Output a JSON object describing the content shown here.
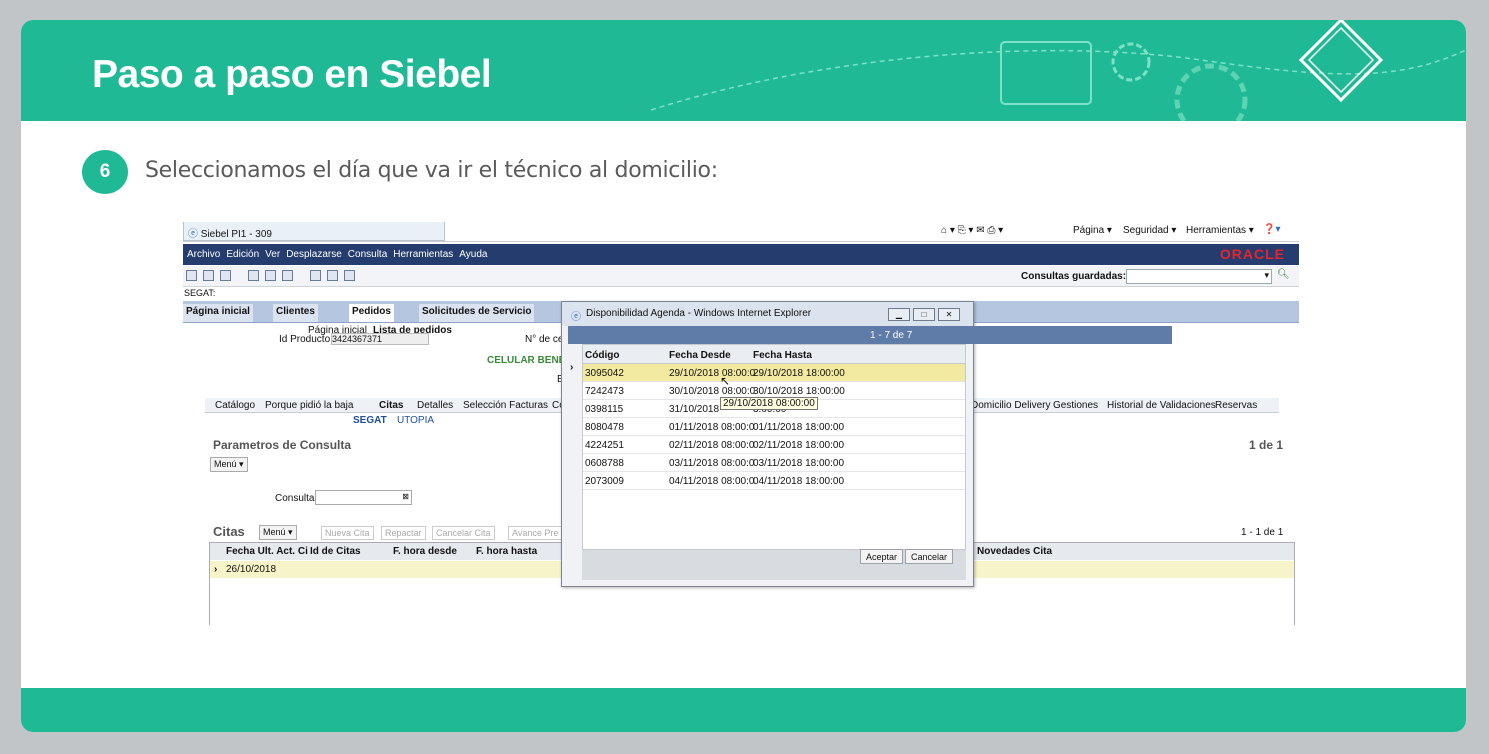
{
  "header": {
    "title": "Paso a paso en Siebel"
  },
  "step": {
    "number": "6",
    "text": "Seleccionamos el día que va ir el técnico al domicilio:"
  },
  "browser": {
    "tab_title": "Siebel PI1 - 309",
    "toolbar": [
      "Página ▾",
      "Seguridad ▾",
      "Herramientas ▾"
    ],
    "menus": [
      "Archivo",
      "Edición",
      "Ver",
      "Desplazarse",
      "Consulta",
      "Herramientas",
      "Ayuda"
    ],
    "oracle": "ORACLE",
    "saved_queries": "Consultas guardadas:"
  },
  "siebel": {
    "segat_label": "SEGAT:",
    "screen_tabs": [
      "Página inicial",
      "Clientes",
      "Pedidos",
      "Solicitudes de Servicio"
    ],
    "breadcrumb": {
      "home": "Página inicial",
      "current": "Lista de pedidos"
    },
    "id_producto": "Id Producto:",
    "id_producto_value": "3424367371",
    "no_de": "N° de ce",
    "celular": "CELULAR BENEFI",
    "e_label": "E",
    "view_tabs_left": [
      "Catálogo",
      "Porque pidió la baja",
      "Citas",
      "Detalles",
      "Selección Facturas",
      "Co"
    ],
    "view_tabs_right": [
      "Domicilio Delivery",
      "Gestiones",
      "Historial de Validaciones",
      "Reservas"
    ],
    "sub_tabs": [
      "SEGAT",
      "UTOPIA"
    ],
    "params_title": "Parametros de Consulta",
    "params_count": "1 de 1",
    "menu_label": "Menú ▾",
    "consulta_label": "Consulta:",
    "citas_title": "Citas",
    "citas_count": "1 - 1 de 1",
    "citas_buttons": [
      "Nueva Cita",
      "Repactar",
      "Cancelar Cita",
      "Avance Pre"
    ],
    "citas_columns": [
      "Fecha Ult. Act. Ci",
      "Id de Citas",
      "F. hora desde",
      "F. hora hasta",
      "Novedades Cita"
    ],
    "citas_row": "26/10/2018"
  },
  "dialog": {
    "title": "Disponibilidad Agenda - Windows Internet Explorer",
    "count": "1 - 7 de 7",
    "columns": [
      "Código",
      "Fecha Desde",
      "Fecha Hasta"
    ],
    "rows": [
      [
        "3095042",
        "29/10/2018 08:00:0",
        "29/10/2018 18:00:00"
      ],
      [
        "7242473",
        "30/10/2018 08:00:0",
        "30/10/2018 18:00:00"
      ],
      [
        "0398115",
        "31/10/2018",
        "3:00:00"
      ],
      [
        "8080478",
        "01/11/2018 08:00:0",
        "01/11/2018 18:00:00"
      ],
      [
        "4224251",
        "02/11/2018 08:00:0",
        "02/11/2018 18:00:00"
      ],
      [
        "0608788",
        "03/11/2018 08:00:0",
        "03/11/2018 18:00:00"
      ],
      [
        "2073009",
        "04/11/2018 08:00:0",
        "04/11/2018 18:00:00"
      ]
    ],
    "tooltip": "29/10/2018 08:00:00",
    "accept": "Aceptar",
    "cancel": "Cancelar"
  },
  "colors": {
    "accent": "#1fba95",
    "menubar": "#243d6e",
    "selected_row": "#f2eaa0"
  }
}
